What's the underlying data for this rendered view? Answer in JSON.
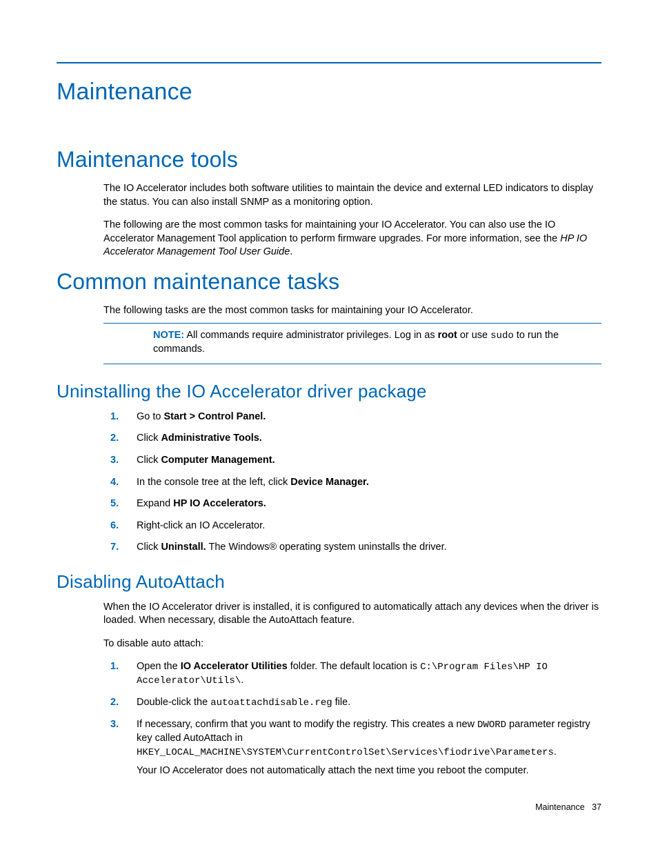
{
  "chapter": "Maintenance",
  "section1": {
    "title": "Maintenance tools",
    "p1": "The IO Accelerator includes both software utilities to maintain the device and external LED indicators to display the status. You can also install SNMP as a monitoring option.",
    "p2a": "The following are the most common tasks for maintaining your IO Accelerator. You can also use the IO Accelerator Management Tool application to perform firmware upgrades. For more information, see the ",
    "p2b_italic": "HP IO Accelerator Management Tool User Guide",
    "p2c": "."
  },
  "section2": {
    "title": "Common maintenance tasks",
    "p1": "The following tasks are the most common tasks for maintaining your IO Accelerator.",
    "note": {
      "label": "NOTE:",
      "t1": "  All commands require administrator privileges. Log in as ",
      "t2_bold": "root",
      "t3": " or use ",
      "t4_mono": "sudo",
      "t5": " to run the commands."
    }
  },
  "sub1": {
    "title": "Uninstalling the IO Accelerator driver package",
    "steps": {
      "s1a": "Go to ",
      "s1b": "Start > Control Panel.",
      "s2a": "Click ",
      "s2b": "Administrative Tools.",
      "s3a": "Click ",
      "s3b": "Computer Management.",
      "s4a": "In the console tree at the left, click ",
      "s4b": "Device Manager.",
      "s5a": "Expand ",
      "s5b": "HP IO Accelerators.",
      "s6": "Right-click an IO Accelerator.",
      "s7a": "Click ",
      "s7b": "Uninstall.",
      "s7c": " The Windows® operating system uninstalls the driver."
    }
  },
  "sub2": {
    "title": "Disabling AutoAttach",
    "p1": "When the IO Accelerator driver is installed, it is configured to automatically attach any devices when the driver is loaded. When necessary, disable the AutoAttach feature.",
    "p2": "To disable auto attach:",
    "steps": {
      "s1a": "Open the ",
      "s1b": "IO Accelerator Utilities",
      "s1c": " folder. The default location is ",
      "s1d_mono": "C:\\Program Files\\HP IO Accelerator\\Utils\\",
      "s1e": ".",
      "s2a": "Double-click the ",
      "s2b_mono": "autoattachdisable.reg",
      "s2c": " file.",
      "s3a": "If necessary, confirm that you want to modify the registry. This creates a new ",
      "s3b_mono": "DWORD",
      "s3c": " parameter registry key called AutoAttach in",
      "s3d_mono": "HKEY_LOCAL_MACHINE\\SYSTEM\\CurrentControlSet\\Services\\fiodrive\\Parameters",
      "s3e": ".",
      "s3f": "Your IO Accelerator does not automatically attach the next time you reboot the computer."
    }
  },
  "footer": {
    "label": "Maintenance",
    "page": "37"
  }
}
